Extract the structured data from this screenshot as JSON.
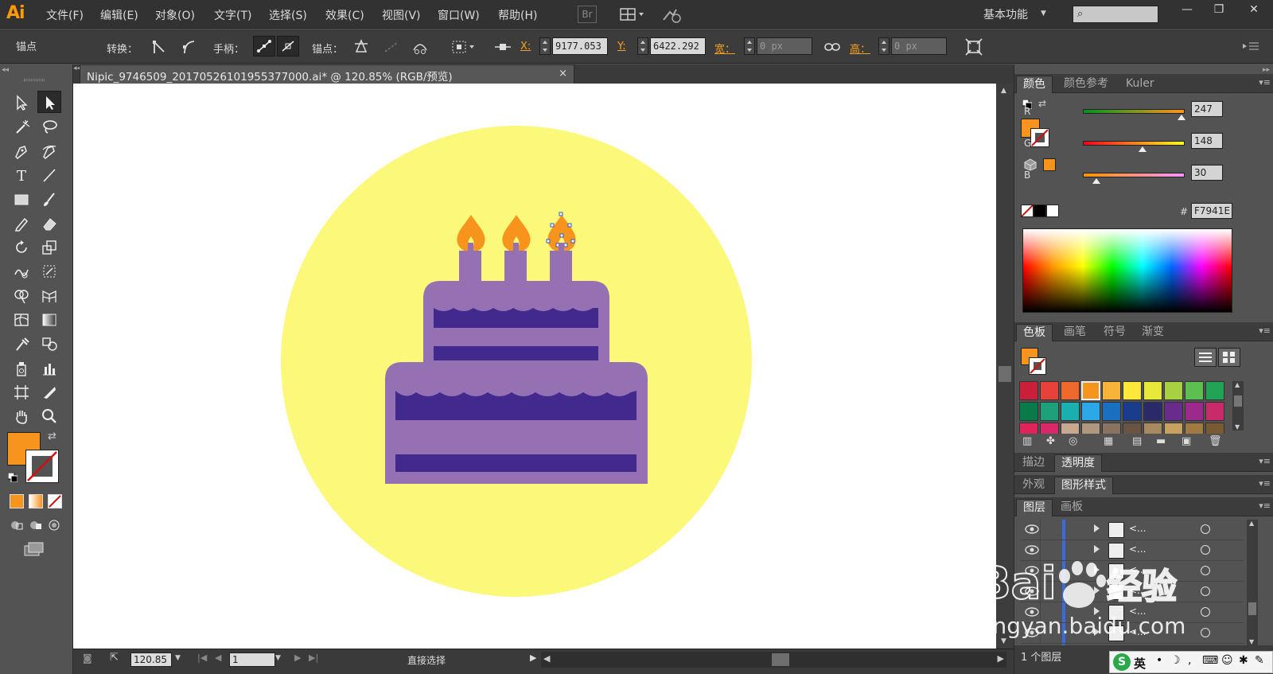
{
  "app": {
    "logo": "Ai"
  },
  "menubar": {
    "items": [
      "文件(F)",
      "编辑(E)",
      "对象(O)",
      "文字(T)",
      "选择(S)",
      "效果(C)",
      "视图(V)",
      "窗口(W)",
      "帮助(H)"
    ],
    "bridge_label": "Br",
    "workspace": "基本功能",
    "search_placeholder": ""
  },
  "controlbar": {
    "mode_label": "锚点",
    "convert_label": "转换：",
    "handles_label": "手柄：",
    "anchor_label": "锚点：",
    "x_label": "X:",
    "x_value": "9177.053",
    "y_label": "Y:",
    "y_value": "6422.292",
    "w_label": "宽：",
    "w_value": "0 px",
    "h_label": "高：",
    "h_value": "0 px"
  },
  "document": {
    "tab_title": "Nipic_9746509_20170526101955377000.ai* @ 120.85% (RGB/预览)",
    "close_glyph": "×"
  },
  "artwork": {
    "background_circle": "#FCF87A",
    "cake_body": "#9570B3",
    "cake_stripe": "#41298E",
    "candle": "#9570B3",
    "flame": "#F7941E"
  },
  "statusbar": {
    "zoom": "120.85",
    "artboard": "1",
    "tool_status": "直接选择"
  },
  "color_panel": {
    "tabs": [
      "颜色",
      "颜色参考",
      "Kuler"
    ],
    "r_label": "R",
    "r_value": "247",
    "g_label": "G",
    "g_value": "148",
    "b_label": "B",
    "b_value": "30",
    "hex_label": "#",
    "hex_value": "F7941E",
    "fill_color": "#F7941E"
  },
  "swatches_panel": {
    "tabs": [
      "色板",
      "画笔",
      "符号",
      "渐变"
    ],
    "colors": [
      "#C8203A",
      "#E8403A",
      "#EE6A2C",
      "#F7941E",
      "#F8B43A",
      "#FFE83A",
      "#E6E83A",
      "#A8D043",
      "#5CBF4F",
      "#22A355",
      "#0A7A4A",
      "#1EA07A",
      "#1AB0B0",
      "#2AA8E8",
      "#1A70C0",
      "#1A3C8C",
      "#2A2A6A",
      "#6A2C8C",
      "#9C2A8C",
      "#C82A6A",
      "#E0245A",
      "#D8286A",
      "#C8A890",
      "#B09880",
      "#8A7260",
      "#6A5444",
      "#A88A60",
      "#C8A060",
      "#A07A40",
      "#7A5A30"
    ]
  },
  "mini_tabs": {
    "stroke": "描边",
    "transparency": "透明度",
    "appearance": "外观",
    "graphic_styles": "图形样式",
    "layers": "图层",
    "artboards": "画板"
  },
  "layers_panel": {
    "rows": [
      {
        "name": "<..."
      },
      {
        "name": "<..."
      },
      {
        "name": "<..."
      },
      {
        "name": "<..."
      },
      {
        "name": "<..."
      },
      {
        "name": "<..."
      }
    ],
    "footer": "1 个图层"
  },
  "watermark": {
    "brand": "Bai 经验",
    "url": "jingyan.baidu.com"
  },
  "ime": {
    "label": "英"
  }
}
